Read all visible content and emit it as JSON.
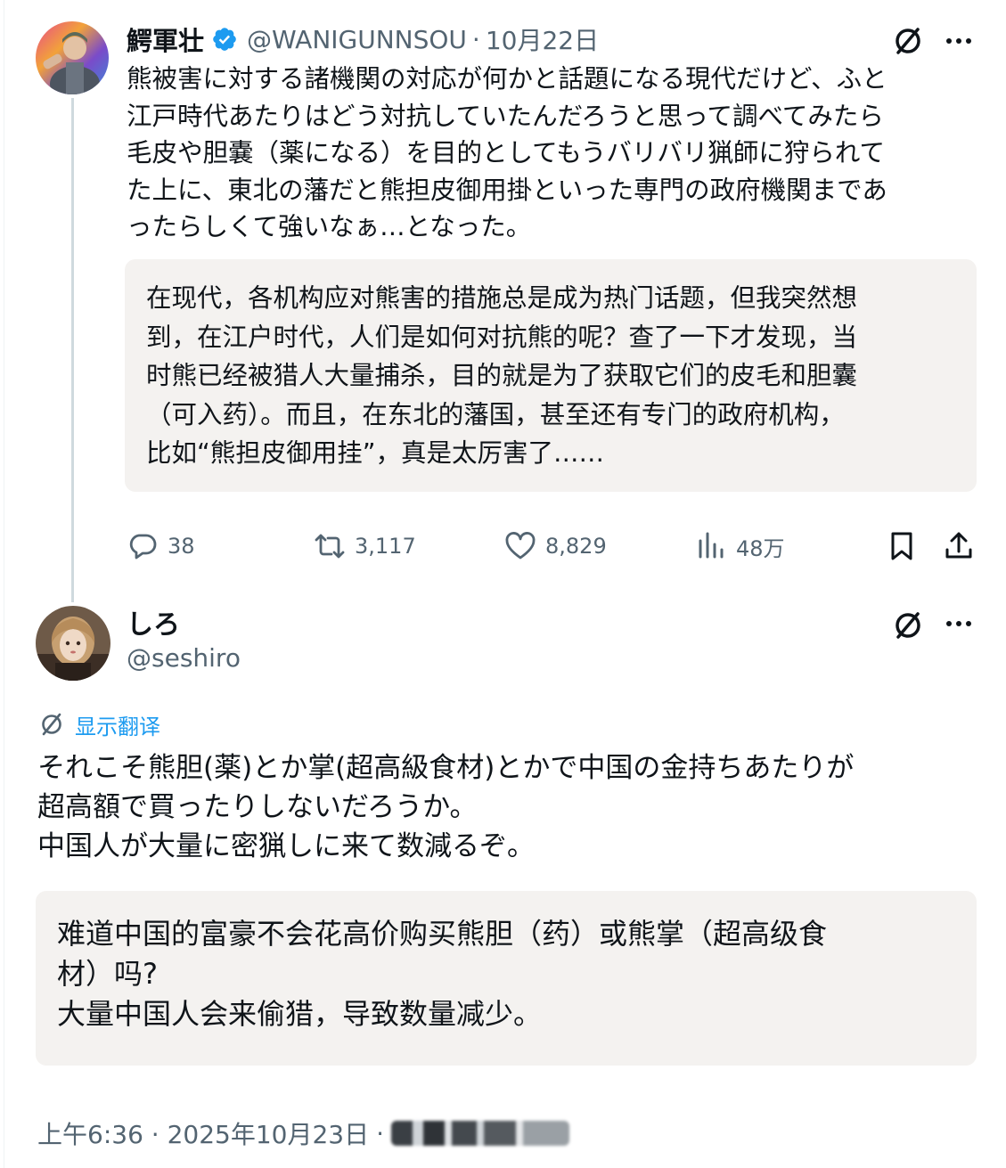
{
  "tweet1": {
    "author_name": "鰐軍壮",
    "handle": "@WANIGUNNSOU",
    "separator": "·",
    "date": "10月22日",
    "body": "熊被害に対する諸機関の対応が何かと話題になる現代だけど、ふと\n江戸時代あたりはどう対抗していたんだろうと思って調べてみたら\n毛皮や胆嚢（薬になる）を目的としてもうバリバリ猟師に狩られて\nた上に、東北の藩だと熊担皮御用掛といった専門の政府機関まであ\nったらしくて強いなぁ…となった。",
    "translation": "在现代，各机构应对熊害的措施总是成为热门话题，但我突然想\n到，在江户时代，人们是如何对抗熊的呢？查了一下才发现，当\n时熊已经被猎人大量捕杀，目的就是为了获取它们的皮毛和胆囊\n（可入药）。而且，在东北的藩国，甚至还有专门的政府机构，\n比如“熊担皮御用挂”，真是太厉害了……",
    "stats": {
      "replies": "38",
      "retweets": "3,117",
      "likes": "8,829",
      "views": "48万"
    },
    "colors": {
      "verified": "#1d9bf0",
      "muted": "#536471"
    }
  },
  "tweet2": {
    "author_name": "しろ",
    "handle": "@seshiro",
    "show_translation_label": "显示翻译",
    "body": "それこそ熊胆(薬)とか掌(超高級食材)とかで中国の金持ちあたりが\n超高額で買ったりしないだろうか。\n中国人が大量に密猟しに来て数減るぞ。",
    "translation": "难道中国的富豪不会花高价购买熊胆（药）或熊掌（超高级食\n材）吗?\n大量中国人会来偷猎，导致数量减少。",
    "timestamp": "上午6:36 · 2025年10月23日",
    "footer_separator": "·"
  },
  "icons": {
    "translate": "translate-slash-icon",
    "more": "more-horizontal-icon",
    "reply": "reply-bubble-icon",
    "retweet": "retweet-icon",
    "like": "heart-icon",
    "views": "bar-chart-icon",
    "bookmark": "bookmark-icon",
    "share": "share-upload-icon"
  }
}
